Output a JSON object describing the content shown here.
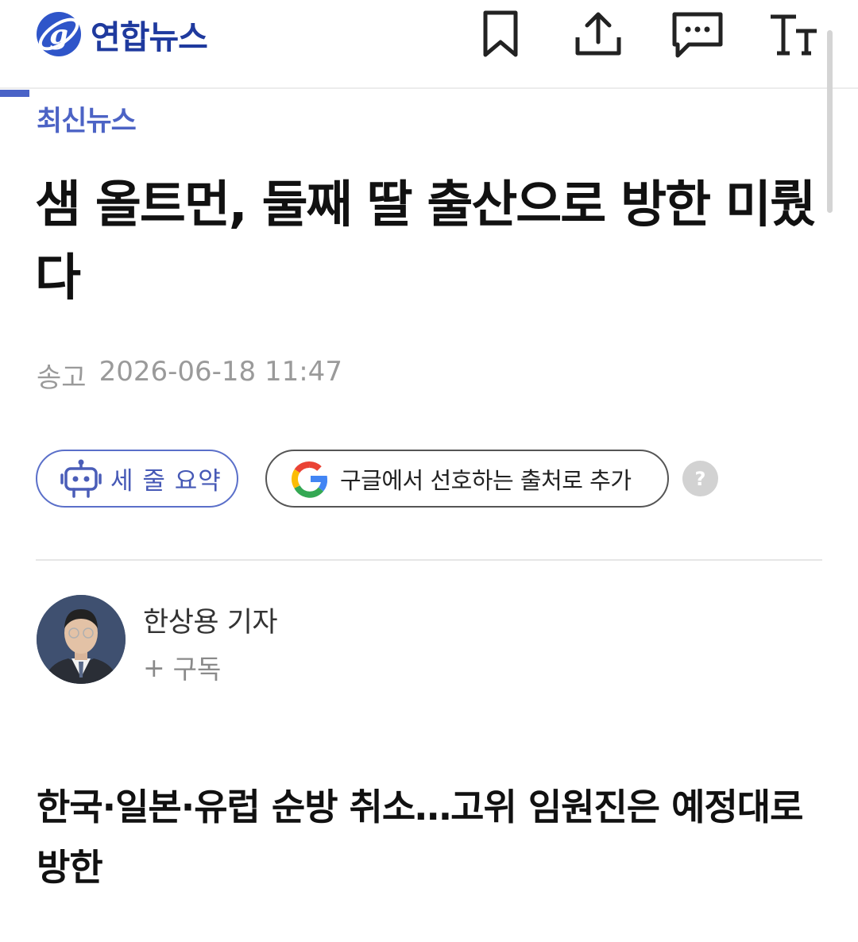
{
  "header": {
    "logo_text": "연합뉴스",
    "actions": [
      {
        "name": "bookmark",
        "icon": "bookmark-icon"
      },
      {
        "name": "share",
        "icon": "share-icon"
      },
      {
        "name": "comments",
        "icon": "comment-icon"
      },
      {
        "name": "font-size",
        "icon": "font-size-icon"
      }
    ]
  },
  "article": {
    "category": "최신뉴스",
    "headline": "샘 올트먼, 둘째 딸 출산으로 방한 미뤘다",
    "sent_label": "송고",
    "sent_datetime": "2026-06-18 11:47",
    "summary_button": "세 줄 요약",
    "google_button": "구글에서 선호하는 출처로 추가",
    "help_symbol": "?",
    "reporter": {
      "name": "한상용 기자",
      "subscribe_symbol": "+",
      "subscribe_label": "구독"
    },
    "subheadline": "한국·일본·유럽 순방 취소…고위 임원진은 예정대로 방한"
  },
  "colors": {
    "brand": "#1f3a9e",
    "category": "#4c63c5",
    "meta_gray": "#9a9a9a"
  }
}
